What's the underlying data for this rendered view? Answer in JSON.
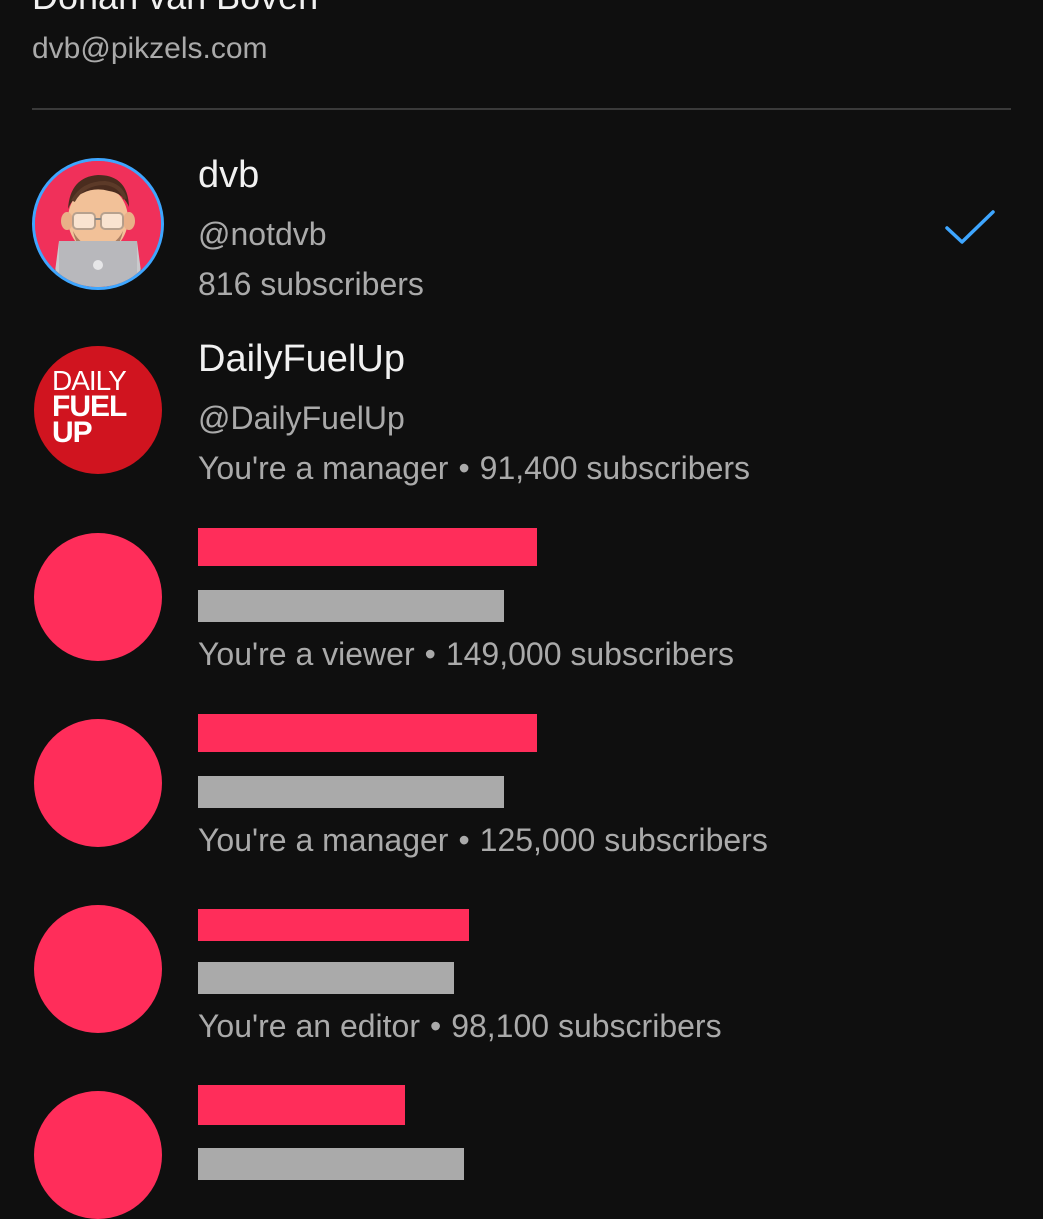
{
  "account": {
    "name": "Donan van Boven",
    "email": "dvb@pikzels.com"
  },
  "channels": [
    {
      "name": "dvb",
      "handle": "@notdvb",
      "subscribers": "816 subscribers",
      "selected": true,
      "avatar": "memoji-laptop-avatar"
    },
    {
      "name": "DailyFuelUp",
      "handle": "@DailyFuelUp",
      "role": "You're a manager",
      "separator": "•",
      "subscribers": "91,400 subscribers",
      "avatar_logo": [
        "DAILY",
        "FUEL",
        "UP"
      ]
    },
    {
      "role": "You're a viewer",
      "separator": "•",
      "subscribers": "149,000 subscribers",
      "redacted": true
    },
    {
      "role": "You're a manager",
      "separator": "•",
      "subscribers": "125,000 subscribers",
      "redacted": true
    },
    {
      "role": "You're an editor",
      "separator": "•",
      "subscribers": "98,100 subscribers",
      "redacted": true
    },
    {
      "redacted": true
    }
  ],
  "colors": {
    "background": "#0f0f0f",
    "accent_check": "#3ea6ff",
    "redaction_pink": "#ff2d5a",
    "redaction_gray": "#aaaaaa",
    "brand_red": "#d0141f"
  },
  "icons": {
    "selected": "checkmark-icon"
  }
}
